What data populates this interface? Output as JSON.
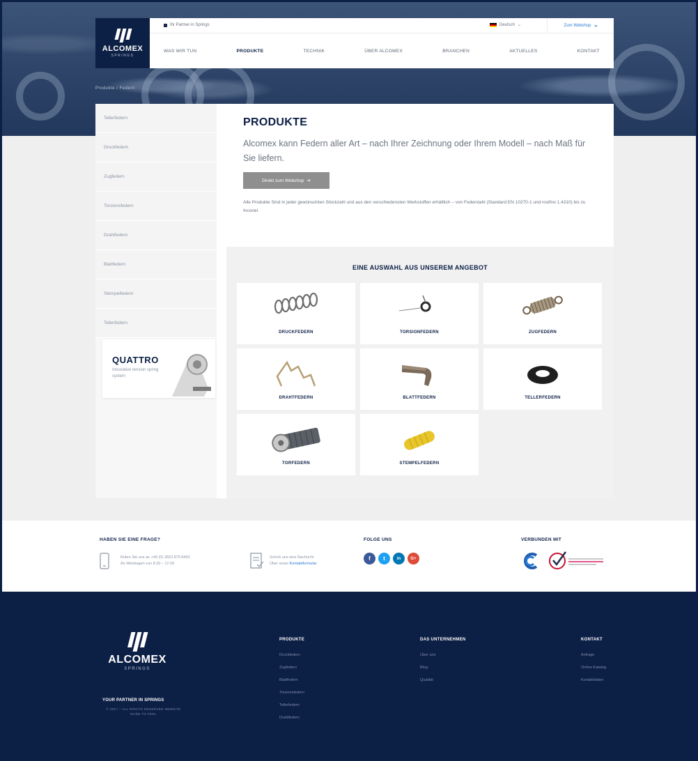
{
  "header": {
    "tagline": "Ihr Partner in Springs",
    "language": "Deutsch",
    "webshop_label": "Zum Webshop",
    "logo_text": "ALCOMEX",
    "logo_sub": "SPRINGS",
    "nav": [
      "WAS WIR TUN",
      "PRODUKTE",
      "TECHNIK",
      "ÜBER ALCOMEX",
      "BRANCHEN",
      "AKTUELLES",
      "KONTAKT"
    ],
    "active_nav": "PRODUKTE"
  },
  "breadcrumb": "Produkte / Federn",
  "sidebar": {
    "items": [
      "Tellerfedern",
      "Druckfedern",
      "Zugfedern",
      "Torsionsfedern",
      "Drahtfedern",
      "Blattfedern",
      "Stempelfedern",
      "Tellerfedern"
    ],
    "promo_title": "QUATTRO",
    "promo_text": "Innovative tension spring system"
  },
  "content": {
    "title": "PRODUKTE",
    "lead": "Alcomex kann Federn aller Art – nach Ihrer Zeichnung oder Ihrem Modell – nach Maß für Sie liefern.",
    "cta_label": "Direkt zum Webshop",
    "body": "Alle Produkte Sind in jeder gewünschten Stückzahl und aus den verschiedensten Werkstoffen erhältlich – von Federstahl (Standard EN 10270-1 und rostfrei 1.4310) bis zu Inconel."
  },
  "offer": {
    "title": "EINE AUSWAHL AUS UNSEREM ANGEBOT",
    "cards": [
      "DRUCKFEDERN",
      "TORSIONFEDERN",
      "ZUGFEDERN",
      "DRAHTFEDERN",
      "BLATTFEDERN",
      "TELLERFEDERN",
      "TORFEDERN",
      "STEMPELFEDERN"
    ]
  },
  "contact": {
    "question_heading": "HABEN SIE EINE FRAGE?",
    "phone_line1": "Rufen Sie uns an +49 (0) 2823 879 8493",
    "phone_line2": "An Werktagen von 8.30 – 17.00",
    "message_line1": "Schick uns eine Nachricht",
    "message_line2_prefix": "Über unser",
    "message_link": "Kontaktformular",
    "follow_heading": "FOLGE UNS",
    "connected_heading": "VERBUNDEN MIT",
    "social": [
      "f",
      "t",
      "in",
      "G+"
    ]
  },
  "footer": {
    "logo_text": "ALCOMEX",
    "logo_sub": "SPRINGS",
    "tagline": "YOUR PARTNER IN SPRINGS",
    "copyright": "© 2017 – ALL RIGHTS RESERVED WEBSITE MADE TO FEEL",
    "col1_heading": "PRODUKTE",
    "col1_items": [
      "Druckfedern",
      "Zugfedern",
      "Blattfedern",
      "Torsionsfedern",
      "Tellerfedern",
      "Drahtfedern"
    ],
    "col2_heading": "DAS UNTERNEHMEN",
    "col2_items": [
      "Über uns",
      "Blog",
      "Qualität"
    ],
    "col3_heading": "KONTAKT",
    "col3_items": [
      "Anfrage",
      "Online Katalog",
      "Kontaktdaten"
    ]
  },
  "colors": {
    "navy": "#0c1f45",
    "link_blue": "#2a7bd4",
    "facebook": "#3b5998",
    "twitter": "#1da1f2",
    "linkedin": "#0077b5",
    "google": "#dd4b39"
  }
}
